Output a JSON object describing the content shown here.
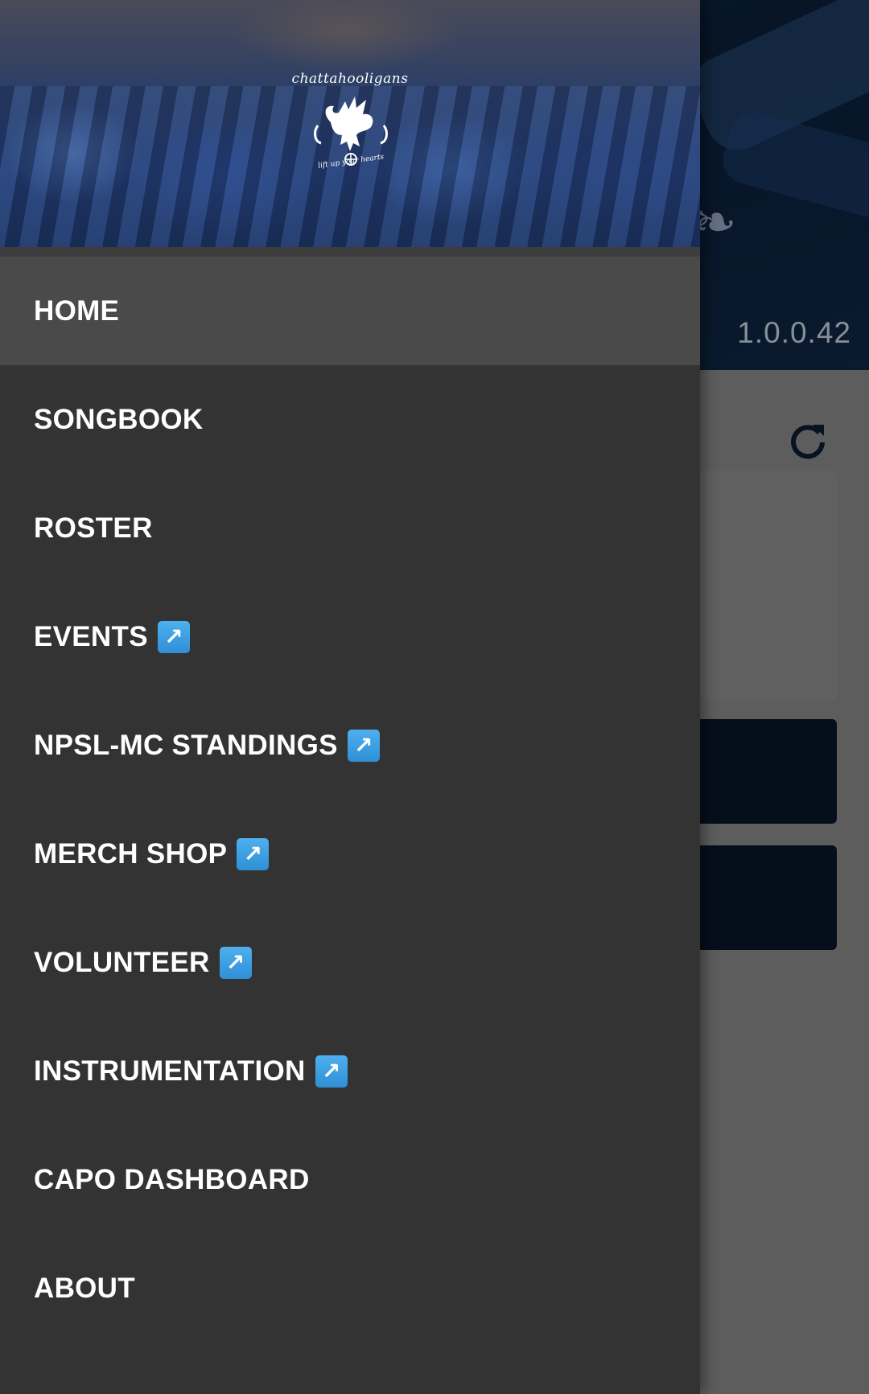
{
  "background": {
    "version": "1.0.0.42",
    "refresh_icon": "refresh-icon"
  },
  "drawer": {
    "header": {
      "logo_text": "chattahooligans",
      "motto": "lift up your hearts"
    },
    "external_icon": "↗",
    "items": [
      {
        "label": "HOME",
        "external": false,
        "active": true
      },
      {
        "label": "SONGBOOK",
        "external": false,
        "active": false
      },
      {
        "label": "ROSTER",
        "external": false,
        "active": false
      },
      {
        "label": "EVENTS",
        "external": true,
        "active": false
      },
      {
        "label": "NPSL-MC STANDINGS",
        "external": true,
        "active": false
      },
      {
        "label": "MERCH SHOP",
        "external": true,
        "active": false
      },
      {
        "label": "VOLUNTEER",
        "external": true,
        "active": false
      },
      {
        "label": "INSTRUMENTATION",
        "external": true,
        "active": false
      },
      {
        "label": "CAPO DASHBOARD",
        "external": false,
        "active": false
      },
      {
        "label": "ABOUT",
        "external": false,
        "active": false
      }
    ]
  },
  "colors": {
    "drawer_bg": "#333333",
    "active_item_bg": "#4a4a4a",
    "header_bg": "#08182c",
    "external_icon_bg": "#2e8fd6"
  }
}
